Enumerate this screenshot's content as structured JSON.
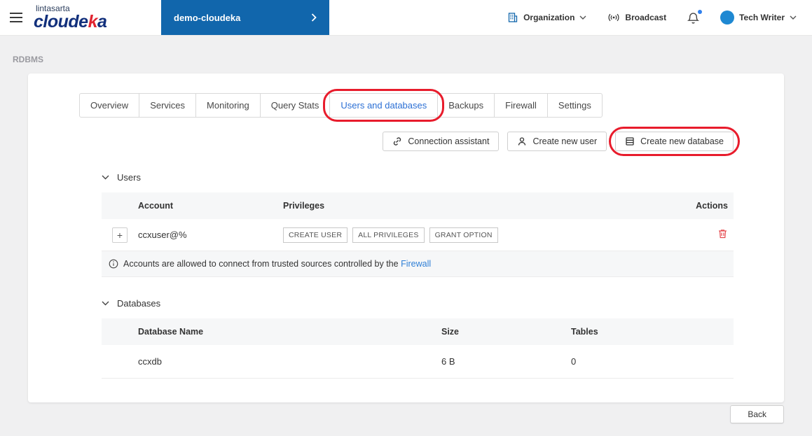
{
  "header": {
    "brand_top": "lintasarta",
    "logo_pre": "cloude",
    "logo_accent": "k",
    "logo_post": "a",
    "project_label": "demo-cloudeka",
    "organization_label": "Organization",
    "broadcast_label": "Broadcast",
    "user_label": "Tech Writer"
  },
  "page": {
    "title": "RDBMS"
  },
  "tabs": [
    {
      "label": "Overview"
    },
    {
      "label": "Services"
    },
    {
      "label": "Monitoring"
    },
    {
      "label": "Query Stats"
    },
    {
      "label": "Users and databases"
    },
    {
      "label": "Backups"
    },
    {
      "label": "Firewall"
    },
    {
      "label": "Settings"
    }
  ],
  "toolbar": {
    "connection_assistant": "Connection assistant",
    "create_user": "Create new user",
    "create_database": "Create new database"
  },
  "users": {
    "title": "Users",
    "col_account": "Account",
    "col_privileges": "Privileges",
    "col_actions": "Actions",
    "row": {
      "expander": "+",
      "account": "ccxuser@%",
      "privileges": [
        "CREATE USER",
        "ALL PRIVILEGES",
        "GRANT OPTION"
      ]
    },
    "info_text": "Accounts are allowed to connect from trusted sources controlled by the",
    "info_link": "Firewall"
  },
  "databases": {
    "title": "Databases",
    "col_name": "Database Name",
    "col_size": "Size",
    "col_tables": "Tables",
    "row": {
      "name": "ccxdb",
      "size": "6 B",
      "tables": "0"
    }
  },
  "footer": {
    "back": "Back"
  },
  "colors": {
    "accent_blue": "#1166ac",
    "brand_navy": "#12307c",
    "link_blue": "#2f7fd6",
    "annotation_red": "#e81c2c",
    "danger_red": "#e5484d"
  }
}
